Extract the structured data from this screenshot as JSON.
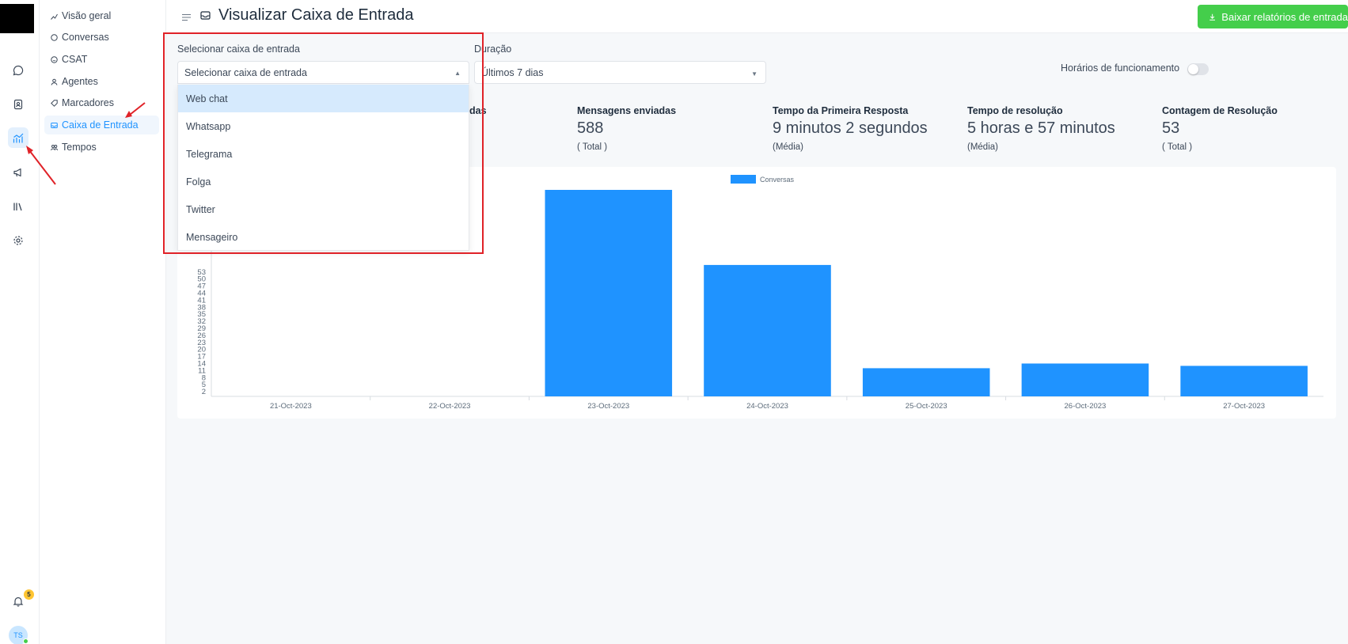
{
  "rail": {
    "icons": [
      "chat-icon",
      "contacts-icon",
      "reports-icon",
      "campaign-icon",
      "library-icon",
      "settings-icon"
    ],
    "notification_count": "5",
    "avatar_initials": "TS"
  },
  "subnav": {
    "items": [
      {
        "label": "Visão geral",
        "icon": "overview-icon"
      },
      {
        "label": "Conversas",
        "icon": "conversations-icon"
      },
      {
        "label": "CSAT",
        "icon": "csat-icon"
      },
      {
        "label": "Agentes",
        "icon": "agents-icon"
      },
      {
        "label": "Marcadores",
        "icon": "tag-icon"
      },
      {
        "label": "Caixa de Entrada",
        "icon": "inbox-icon",
        "active": true
      },
      {
        "label": "Tempos",
        "icon": "teams-icon"
      }
    ]
  },
  "header": {
    "title": "Visualizar Caixa de Entrada",
    "download_label": "Baixar relatórios de entrada",
    "download_color": "#44ce4b"
  },
  "filters": {
    "inbox_label": "Selecionar caixa de entrada",
    "inbox_placeholder": "Selecionar caixa de entrada",
    "duration_label": "Duração",
    "duration_value": "Últimos 7 dias",
    "business_hours_label": "Horários de funcionamento",
    "business_hours_on": false
  },
  "dropdown": {
    "options": [
      "Web chat",
      "Whatsapp",
      "Telegrama",
      "Folga",
      "Twitter",
      "Mensageiro"
    ],
    "highlighted": "Web chat"
  },
  "metrics": [
    {
      "title": "Mensagens enviadas",
      "value": "588",
      "sub": "( Total )"
    },
    {
      "title": "Tempo da Primeira Resposta",
      "value": "9 minutos 2 segundos",
      "sub": "(Média)"
    },
    {
      "title": "Tempo de resolução",
      "value": "5 horas e 57 minutos",
      "sub": "(Média)"
    },
    {
      "title": "Contagem de Resolução",
      "value": "53",
      "sub": "( Total )"
    }
  ],
  "partial_metric_fragment": "das",
  "chart_data": {
    "type": "bar",
    "categories": [
      "21-Oct-2023",
      "22-Oct-2023",
      "23-Oct-2023",
      "24-Oct-2023",
      "25-Oct-2023",
      "26-Oct-2023",
      "27-Oct-2023"
    ],
    "series": [
      {
        "name": "Conversas",
        "values": [
          0,
          0,
          88,
          56,
          12,
          14,
          13
        ]
      }
    ],
    "visible_y_ticks": [
      2,
      5,
      8,
      11,
      14,
      17,
      20,
      23,
      26,
      29,
      32,
      35,
      38,
      41,
      44,
      47,
      50,
      53
    ],
    "ylim": [
      0,
      88
    ],
    "color": "#1f93ff",
    "legend_position": "top-center",
    "grid": false
  }
}
